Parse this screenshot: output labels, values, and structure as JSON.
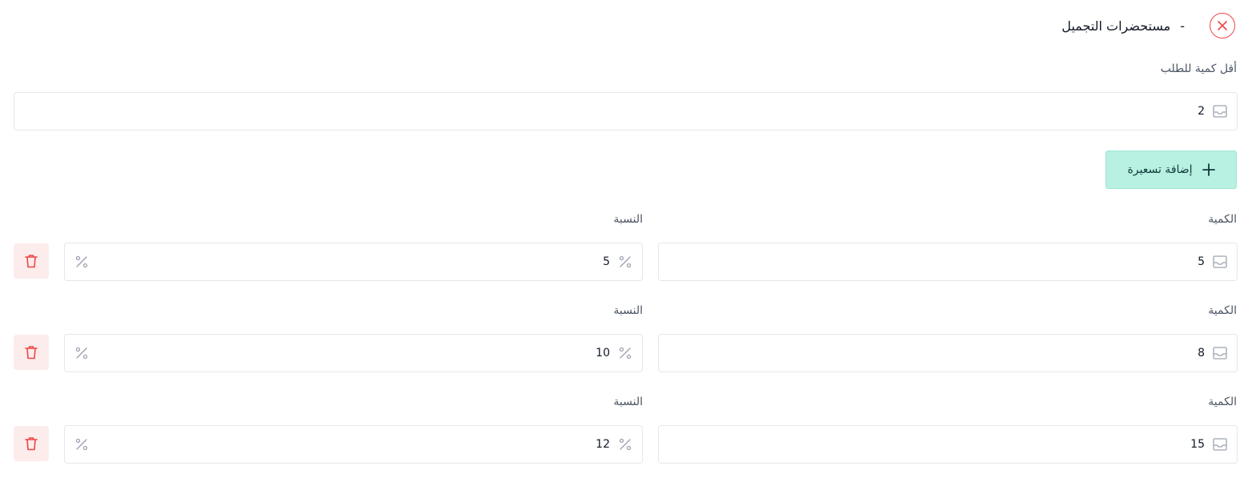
{
  "header": {
    "title": "مستحضرات التجميل",
    "separator": "-"
  },
  "min_order": {
    "label": "أقل كمية للطلب",
    "value": "2"
  },
  "add_pricing_label": "إضافة تسعيرة",
  "tiers": [
    {
      "quantity_label": "الكمية",
      "quantity": "5",
      "percent_label": "النسبة",
      "percent": "5"
    },
    {
      "quantity_label": "الكمية",
      "quantity": "8",
      "percent_label": "النسبة",
      "percent": "10"
    },
    {
      "quantity_label": "الكمية",
      "quantity": "15",
      "percent_label": "النسبة",
      "percent": "12"
    }
  ],
  "colors": {
    "accent_bg": "#b8f0e2",
    "danger": "#ef4444",
    "danger_bg": "#fdecec"
  },
  "icons": {
    "close": "close-icon",
    "input": "inbox-icon",
    "percent": "percent-icon",
    "add": "plus-icon",
    "delete": "trash-icon"
  }
}
